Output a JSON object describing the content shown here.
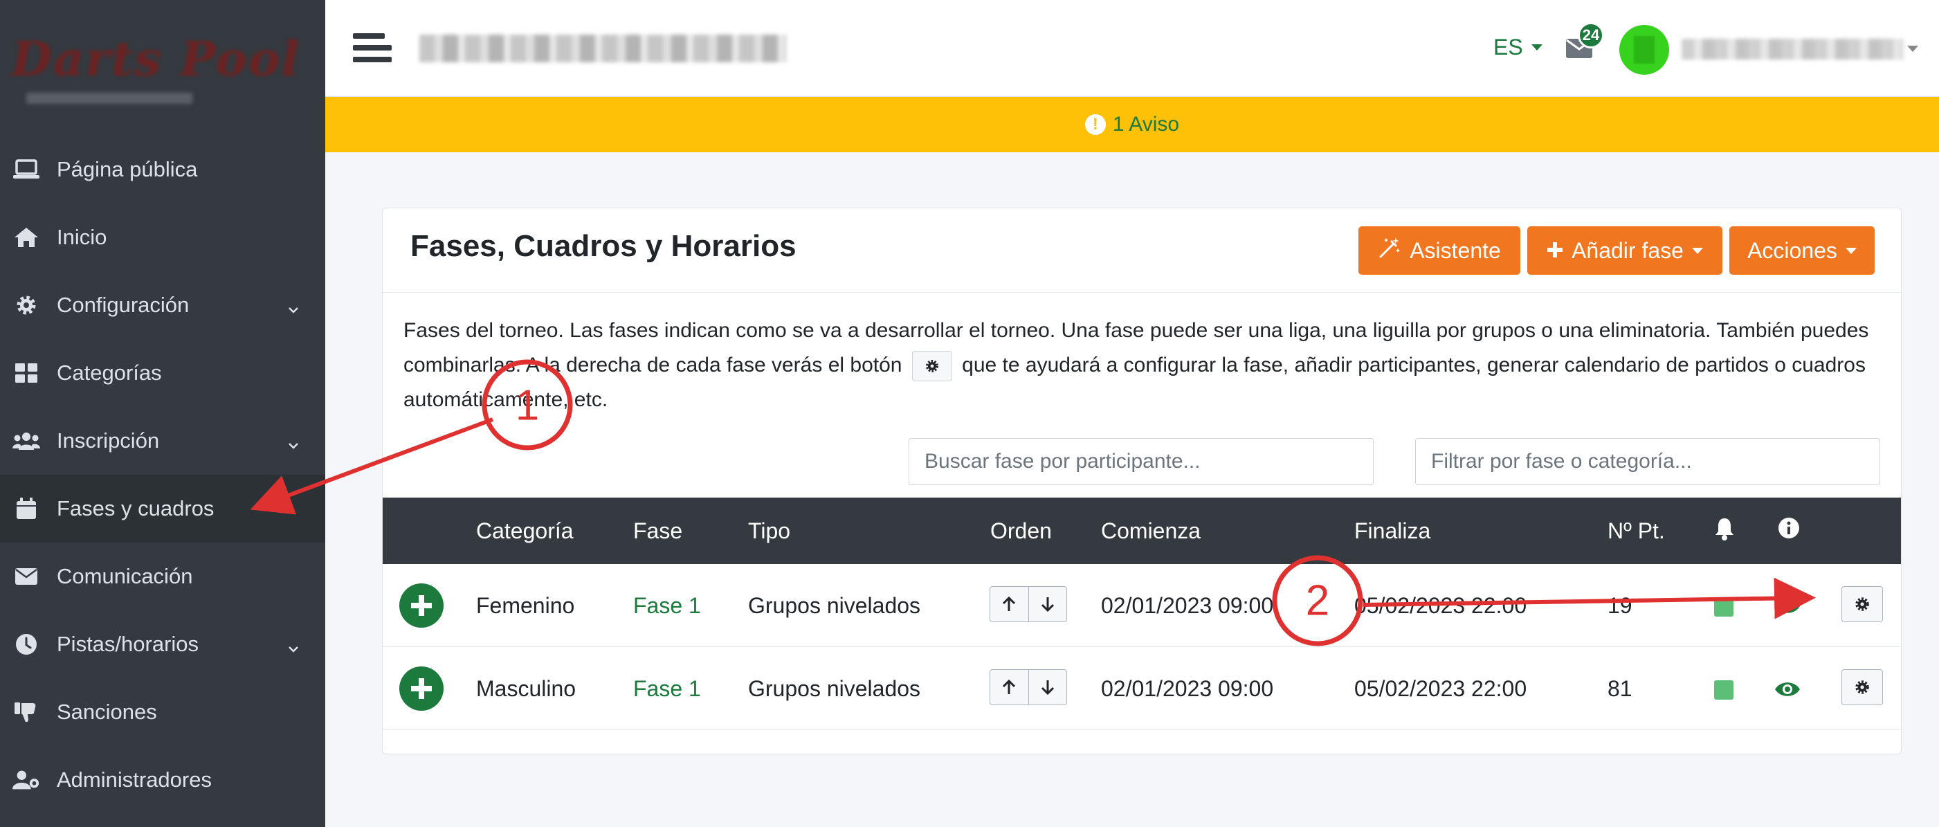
{
  "sidebar": {
    "items": [
      {
        "label": "Página pública",
        "icon": "laptop-icon",
        "chevron": false
      },
      {
        "label": "Inicio",
        "icon": "home-icon",
        "chevron": false
      },
      {
        "label": "Configuración",
        "icon": "gear-icon",
        "chevron": true
      },
      {
        "label": "Categorías",
        "icon": "grid-icon",
        "chevron": false
      },
      {
        "label": "Inscripción",
        "icon": "users-icon",
        "chevron": true
      },
      {
        "label": "Fases y cuadros",
        "icon": "calendar-icon",
        "chevron": false,
        "active": true
      },
      {
        "label": "Comunicación",
        "icon": "envelope-icon",
        "chevron": false
      },
      {
        "label": "Pistas/horarios",
        "icon": "clock-icon",
        "chevron": true
      },
      {
        "label": "Sanciones",
        "icon": "thumbs-down-icon",
        "chevron": false
      },
      {
        "label": "Administradores",
        "icon": "user-gear-icon",
        "chevron": false
      }
    ]
  },
  "header": {
    "lang": "ES",
    "mail_badge": "24"
  },
  "warning": {
    "text": "1 Aviso"
  },
  "card": {
    "title": "Fases, Cuadros y Horarios",
    "buttons": {
      "asistente": "Asistente",
      "anadir": "Añadir fase",
      "acciones": "Acciones"
    },
    "description_part1": "Fases del torneo. Las fases indican como se va a desarrollar el torneo. Una fase puede ser una liga, una liguilla por grupos o una eliminatoria. También puedes combinarlas. A la derecha de cada fase verás el botón",
    "description_part2": "que te ayudará a configurar la fase, añadir participantes, generar calendario de partidos o cuadros automáticamente, etc.",
    "search_participant_placeholder": "Buscar fase por participante...",
    "filter_placeholder": "Filtrar por fase o categoría..."
  },
  "table": {
    "headers": {
      "categoria": "Categoría",
      "fase": "Fase",
      "tipo": "Tipo",
      "orden": "Orden",
      "comienza": "Comienza",
      "finaliza": "Finaliza",
      "npt": "Nº Pt."
    },
    "rows": [
      {
        "categoria": "Femenino",
        "fase": "Fase 1",
        "tipo": "Grupos nivelados",
        "comienza": "02/01/2023 09:00",
        "finaliza": "05/02/2023 22:00",
        "npt": "19"
      },
      {
        "categoria": "Masculino",
        "fase": "Fase 1",
        "tipo": "Grupos nivelados",
        "comienza": "02/01/2023 09:00",
        "finaliza": "05/02/2023 22:00",
        "npt": "81"
      }
    ]
  },
  "annotations": {
    "label1": "1",
    "label2": "2",
    "color": "#e03131"
  },
  "colors": {
    "sidebar": "#343a40",
    "accent_green": "#1b7a3c",
    "orange": "#f0761f",
    "warning": "#ffc107"
  }
}
